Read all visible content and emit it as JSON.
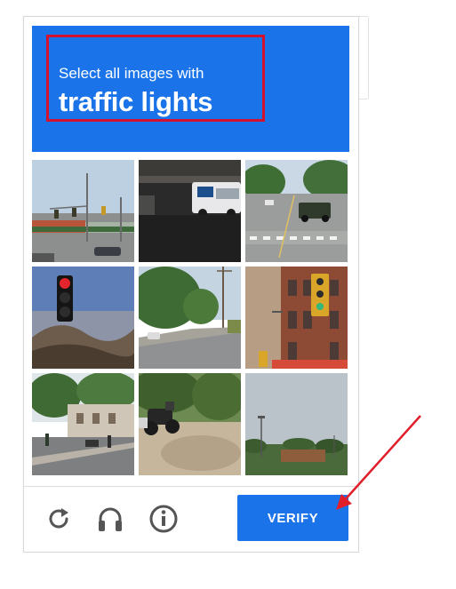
{
  "challenge": {
    "instruction": "Select all images with",
    "target": "traffic lights"
  },
  "colors": {
    "accent": "#1a73e8",
    "highlight_border": "#d2122e",
    "annotation_arrow": "#e01f2b",
    "icon_gray": "#555555"
  },
  "tiles": [
    {
      "name": "tile-1",
      "scene": "intersection with traffic lights on poles and shops"
    },
    {
      "name": "tile-2",
      "scene": "van parked under overpass"
    },
    {
      "name": "tile-3",
      "scene": "road with vehicles and crosswalk"
    },
    {
      "name": "tile-4",
      "scene": "close-up red traffic light against sky"
    },
    {
      "name": "tile-5",
      "scene": "tree-lined street"
    },
    {
      "name": "tile-6",
      "scene": "traffic light in front of brick building"
    },
    {
      "name": "tile-7",
      "scene": "city street with trees and people"
    },
    {
      "name": "tile-8",
      "scene": "motorcycle parked near bushes"
    },
    {
      "name": "tile-9",
      "scene": "sky over low buildings"
    }
  ],
  "footer": {
    "reload_icon": "reload-icon",
    "audio_icon": "headphones-icon",
    "info_icon": "info-icon",
    "verify_label": "VERIFY"
  }
}
